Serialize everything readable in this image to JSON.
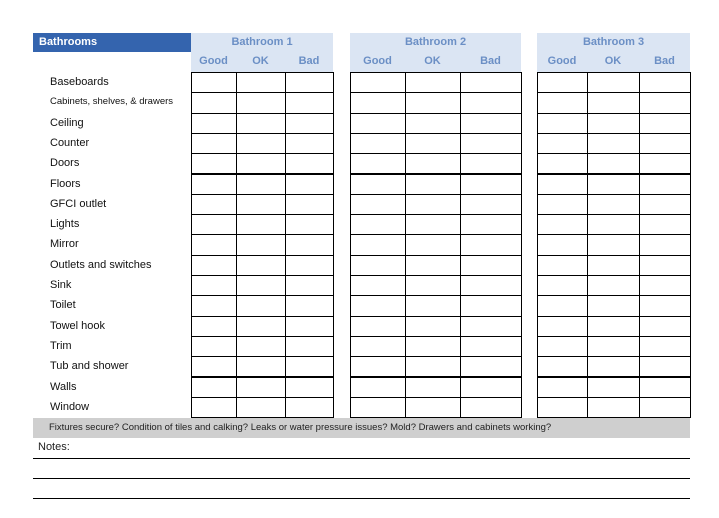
{
  "title": "Bathrooms",
  "groups": [
    {
      "name": "Bathroom 1",
      "cols": [
        "Good",
        "OK",
        "Bad"
      ]
    },
    {
      "name": "Bathroom 2",
      "cols": [
        "Good",
        "OK",
        "Bad"
      ]
    },
    {
      "name": "Bathroom 3",
      "cols": [
        "Good",
        "OK",
        "Bad"
      ]
    }
  ],
  "items": [
    "Baseboards",
    "Cabinets, shelves, & drawers",
    "Ceiling",
    "Counter",
    "Doors",
    "Floors",
    "GFCI outlet",
    "Lights",
    "Mirror",
    "Outlets and switches",
    "Sink",
    "Toilet",
    "Towel hook",
    "Trim",
    "Tub and shower",
    "Walls",
    "Window"
  ],
  "tip": "Fixtures secure? Condition of tiles and calking? Leaks or water pressure issues? Mold? Drawers and cabinets working?",
  "notes_label": "Notes:"
}
